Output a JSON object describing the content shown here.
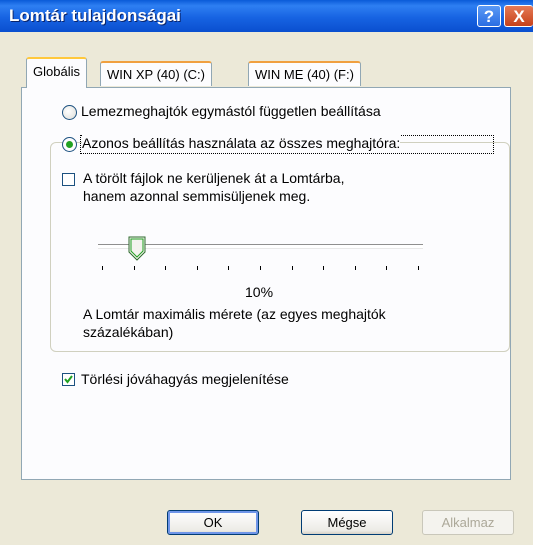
{
  "window": {
    "title": "Lomtár tulajdonságai"
  },
  "titlebar_buttons": {
    "help": "?",
    "close": "X"
  },
  "tabs": [
    {
      "label": "Globális"
    },
    {
      "label": "WIN XP (40) (C:)"
    },
    {
      "label": "WIN ME (40) (F:)"
    }
  ],
  "options": {
    "radio_independent": "Lemezmeghajtók egymástól független beállítása",
    "radio_same": "Azonos beállítás használata az összes meghajtóra:",
    "radio_selected": "same",
    "delete_immediately_line1": "A törölt fájlok ne kerüljenek át a Lomtárba,",
    "delete_immediately_line2": "hanem azonnal semmisüljenek meg.",
    "delete_immediately_checked": false,
    "slider_value_text": "10%",
    "slider_value": 10,
    "max_size_line1": "A Lomtár maximális mérete (az egyes meghajtók",
    "max_size_line2": "százalékában)",
    "confirm_delete": "Törlési jóváhagyás megjelenítése",
    "confirm_delete_checked": true
  },
  "buttons": {
    "ok": "OK",
    "cancel": "Mégse",
    "apply": "Alkalmaz"
  }
}
